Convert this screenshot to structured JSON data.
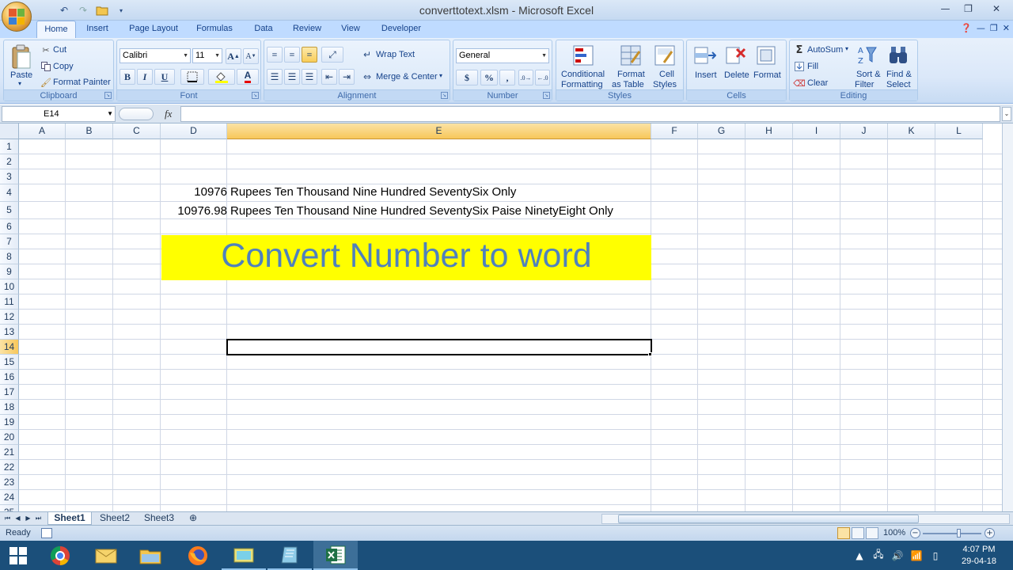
{
  "window": {
    "title": "converttotext.xlsm - Microsoft Excel"
  },
  "tabs": [
    "Home",
    "Insert",
    "Page Layout",
    "Formulas",
    "Data",
    "Review",
    "View",
    "Developer"
  ],
  "ribbon": {
    "clipboard": {
      "paste": "Paste",
      "cut": "Cut",
      "copy": "Copy",
      "format_painter": "Format Painter",
      "label": "Clipboard"
    },
    "font": {
      "name": "Calibri",
      "size": "11",
      "bold": "B",
      "italic": "I",
      "underline": "U",
      "label": "Font"
    },
    "alignment": {
      "wrap_text": "Wrap Text",
      "merge_center": "Merge & Center",
      "label": "Alignment"
    },
    "number": {
      "format": "General",
      "currency": "$",
      "percent": "%",
      "comma": ",",
      "label": "Number"
    },
    "styles": {
      "conditional": "Conditional",
      "conditional2": "Formatting",
      "format_as": "Format",
      "format_as2": "as Table",
      "cell": "Cell",
      "cell2": "Styles",
      "label": "Styles"
    },
    "cells": {
      "insert": "Insert",
      "delete": "Delete",
      "format": "Format",
      "label": "Cells"
    },
    "editing": {
      "autosum": "AutoSum",
      "fill": "Fill",
      "clear": "Clear",
      "sort": "Sort &",
      "sort2": "Filter",
      "find": "Find &",
      "find2": "Select",
      "label": "Editing"
    }
  },
  "formula_bar": {
    "name_box": "E14",
    "fx": "fx",
    "formula": ""
  },
  "columns": [
    "A",
    "B",
    "C",
    "D",
    "E",
    "F",
    "G",
    "H",
    "I",
    "J",
    "K",
    "L"
  ],
  "rows": [
    "1",
    "2",
    "3",
    "4",
    "5",
    "6",
    "7",
    "8",
    "9",
    "10",
    "11",
    "12",
    "13",
    "14",
    "15",
    "16",
    "17",
    "18",
    "19",
    "20",
    "21",
    "22",
    "23",
    "24",
    "25"
  ],
  "cells": {
    "D4": "10976",
    "E4": "Rupees Ten Thousand Nine Hundred SeventySix Only",
    "D5": "10976.98",
    "E5": "Rupees Ten Thousand Nine Hundred SeventySix Paise NinetyEight Only",
    "title": "Convert Number to word"
  },
  "sheets": [
    "Sheet1",
    "Sheet2",
    "Sheet3"
  ],
  "active_sheet": "Sheet1",
  "status": {
    "text": "Ready",
    "zoom": "100%"
  },
  "taskbar": {
    "time": "4:07 PM",
    "date": "29-04-18"
  },
  "colors": {
    "title_fill": "#ffff00",
    "title_text": "#4f81bd",
    "selected_header": "#f7c75a"
  }
}
